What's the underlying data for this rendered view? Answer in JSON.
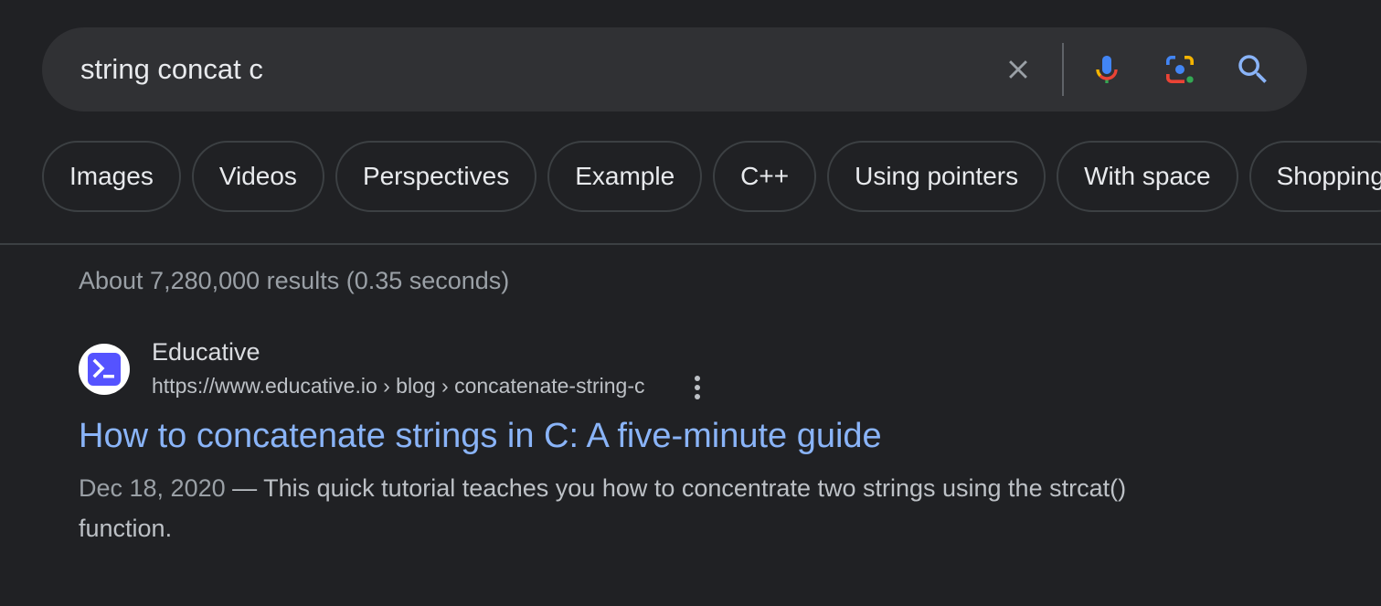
{
  "search": {
    "query": "string concat c"
  },
  "icons": {
    "clear": "close-icon",
    "voice": "microphone-icon",
    "lens": "google-lens-icon",
    "submit": "search-icon",
    "favicon": "educative-terminal-icon",
    "more": "more-vert-icon"
  },
  "chips": [
    "Images",
    "Videos",
    "Perspectives",
    "Example",
    "C++",
    "Using pointers",
    "With space",
    "Shopping"
  ],
  "result_stats": "About 7,280,000 results (0.35 seconds)",
  "result": {
    "site_name": "Educative",
    "url": "https://www.educative.io › blog › concatenate-string-c",
    "title": "How to concatenate strings in C: A five-minute guide",
    "date": "Dec 18, 2020",
    "separator": " — ",
    "snippet": "This quick tutorial teaches you how to concentrate two strings using the strcat() function."
  },
  "colors": {
    "background": "#202124",
    "search_bg": "#303134",
    "link": "#8ab4f8",
    "favicon_brand": "#5553ff"
  }
}
